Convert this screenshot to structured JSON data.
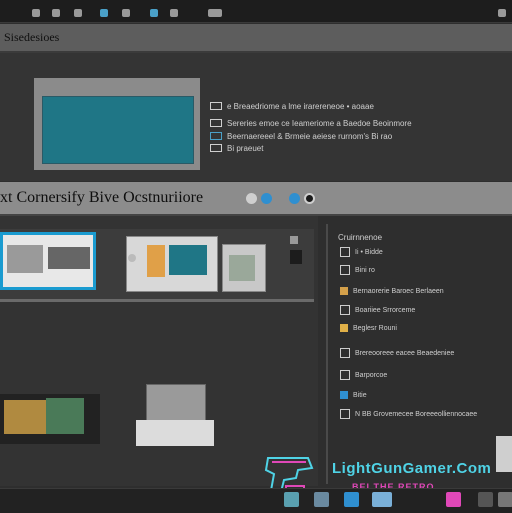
{
  "top_bar": {
    "icons": [
      "app-icon",
      "tab-icon",
      "file-icon",
      "edit-icon",
      "view-icon",
      "tools-icon",
      "window-icon",
      "grid-icon",
      "help-icon"
    ]
  },
  "banner": {
    "title": "Sisedesioes"
  },
  "info_panel": {
    "rows": [
      {
        "icon": "list-icon",
        "text": "e Breaedriome a lme irarereneoe • aoaae"
      },
      {
        "icon": "list-icon",
        "text": "Sereries emoe ce Ieameriome a Baedoe Beoinmore"
      },
      {
        "icon": "gear-icon",
        "text": "Beernaereeel & Brmeie aeiese rurnom's Bi rao"
      },
      {
        "icon": "list-icon",
        "text": "Bi praeuet"
      }
    ]
  },
  "section": {
    "title": "xt Cornersify  Bive Ocstnuriiore",
    "icons": [
      "back-icon",
      "globe-icon",
      "share-icon",
      "settings-icon"
    ]
  },
  "properties": {
    "header": "Cruirnnenoe",
    "rows": [
      {
        "icon": "list-icon",
        "text": "Ii • Bidde"
      },
      {
        "icon": "list-icon",
        "text": "Bini ro"
      },
      {
        "icon": "gear-icon",
        "text": "Bernaorerie Baroec Berlaeen"
      },
      {
        "icon": "list-icon",
        "text": "Boariiee Srrorceme"
      },
      {
        "icon": "star-icon",
        "text": "Beglesr Rouni"
      },
      {
        "icon": "text-icon",
        "text": "Brereooreee eacee Beaedeniee"
      },
      {
        "icon": "text-icon",
        "text": "Barporcoe"
      },
      {
        "icon": "image-icon",
        "text": "Bitie"
      },
      {
        "icon": "text-icon",
        "text": "N BB Grovemecee Boreeeolliennocaee"
      }
    ]
  },
  "watermark": {
    "title": "LightGunGamer.Com",
    "subtitle": "BEI THE RETRO"
  },
  "colors": {
    "accent": "#1f7686",
    "watermark_cyan": "#4fd3e6",
    "watermark_magenta": "#e048b8"
  }
}
